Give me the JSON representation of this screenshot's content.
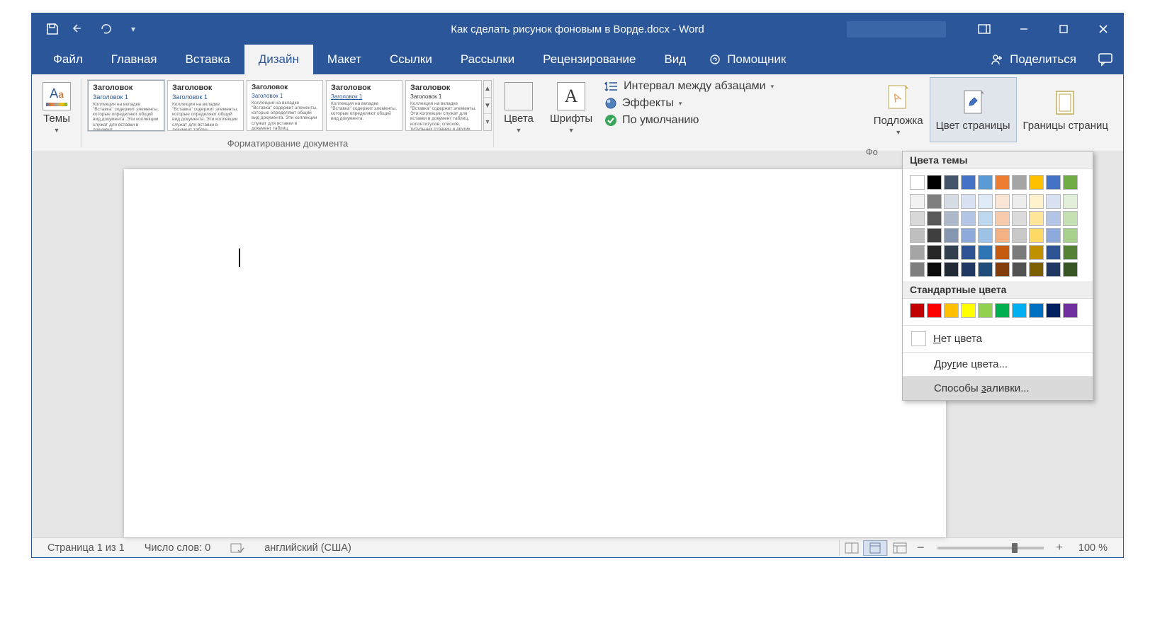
{
  "titlebar": {
    "title": "Как сделать рисунок фоновым в Ворде.docx  -  Word"
  },
  "tabs": {
    "file": "Файл",
    "home": "Главная",
    "insert": "Вставка",
    "design": "Дизайн",
    "layout": "Макет",
    "references": "Ссылки",
    "mailings": "Рассылки",
    "review": "Рецензирование",
    "view": "Вид",
    "tellme": "Помощник",
    "share": "Поделиться"
  },
  "ribbon": {
    "themes": "Темы",
    "doc_format_label": "Форматирование документа",
    "gallery_heading": "Заголовок",
    "gallery_sub": "Заголовок 1",
    "colors": "Цвета",
    "fonts": "Шрифты",
    "spacing": "Интервал между абзацами",
    "effects": "Эффекты",
    "default": "По умолчанию",
    "watermark": "Подложка",
    "page_color": "Цвет страницы",
    "page_borders": "Границы страниц",
    "bg_group_label_partial": "Фо"
  },
  "dropdown": {
    "theme_colors": "Цвета темы",
    "standard_colors": "Стандартные цвета",
    "no_color_pre": "Н",
    "no_color_post": "ет цвета",
    "more_colors_pre": "Дру",
    "more_colors_u": "г",
    "more_colors_post": "ие цвета...",
    "fill_effects_pre": "Способы ",
    "fill_effects_u": "з",
    "fill_effects_post": "аливки...",
    "theme_row1": [
      "#ffffff",
      "#000000",
      "#44546a",
      "#4472c4",
      "#5b9bd5",
      "#ed7d31",
      "#a5a5a5",
      "#ffc000",
      "#4472c4",
      "#70ad47"
    ],
    "theme_matrix": [
      [
        "#f2f2f2",
        "#7f7f7f",
        "#d6dce4",
        "#d9e2f3",
        "#deebf6",
        "#fbe5d5",
        "#ededed",
        "#fff2cc",
        "#d9e2f3",
        "#e2efd9"
      ],
      [
        "#d8d8d8",
        "#595959",
        "#adb9ca",
        "#b4c6e7",
        "#bdd7ee",
        "#f7cbac",
        "#dbdbdb",
        "#fee599",
        "#b4c6e7",
        "#c5e0b3"
      ],
      [
        "#bfbfbf",
        "#3f3f3f",
        "#8496b0",
        "#8eaadb",
        "#9cc3e5",
        "#f4b183",
        "#c9c9c9",
        "#ffd965",
        "#8eaadb",
        "#a8d08d"
      ],
      [
        "#a5a5a5",
        "#262626",
        "#323f4f",
        "#2f5496",
        "#2e75b5",
        "#c55a11",
        "#7b7b7b",
        "#bf9000",
        "#2f5496",
        "#538135"
      ],
      [
        "#7f7f7f",
        "#0c0c0c",
        "#222a35",
        "#1f3864",
        "#1e4e79",
        "#833c0b",
        "#525252",
        "#7f6000",
        "#1f3864",
        "#375623"
      ]
    ],
    "standard_row": [
      "#c00000",
      "#ff0000",
      "#ffc000",
      "#ffff00",
      "#92d050",
      "#00b050",
      "#00b0f0",
      "#0070c0",
      "#002060",
      "#7030a0"
    ]
  },
  "statusbar": {
    "page": "Страница 1 из 1",
    "words": "Число слов: 0",
    "lang": "английский (США)",
    "zoom": "100 %"
  }
}
